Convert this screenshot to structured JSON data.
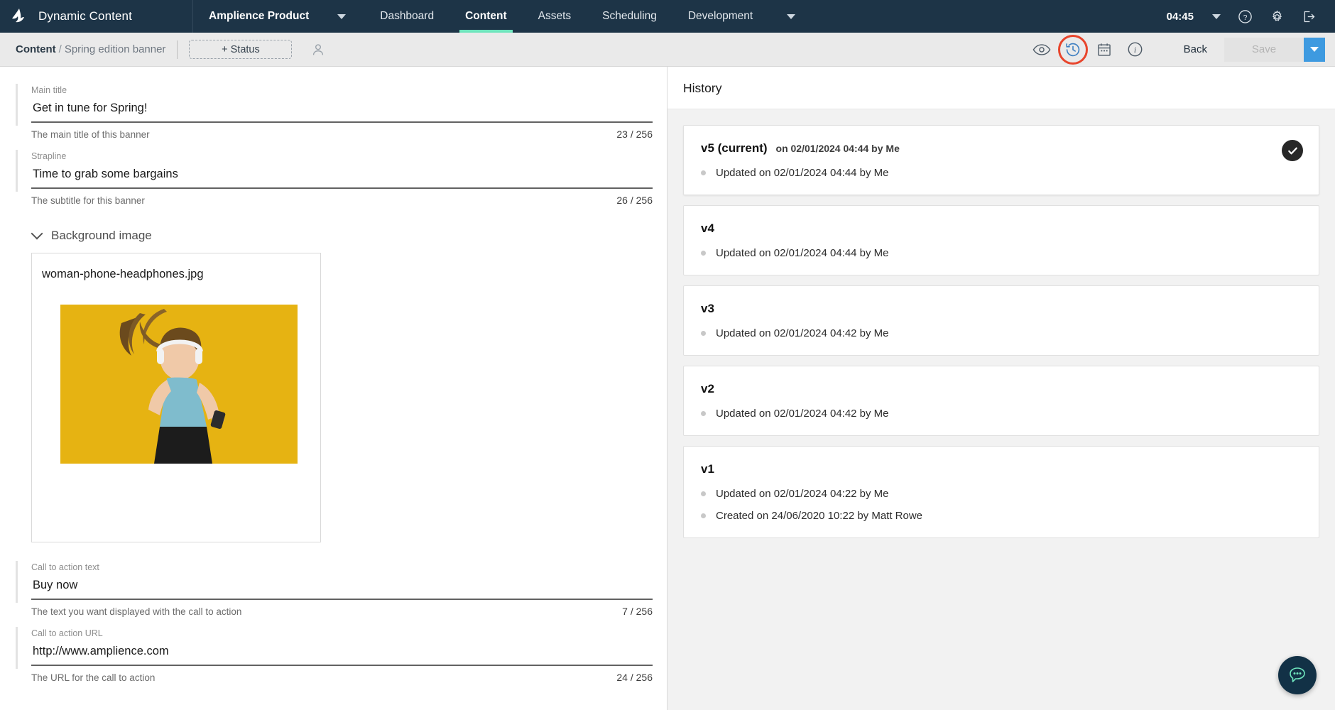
{
  "topnav": {
    "brand": "Dynamic Content",
    "product": "Amplience Product",
    "items": [
      {
        "label": "Dashboard",
        "active": false
      },
      {
        "label": "Content",
        "active": true
      },
      {
        "label": "Assets",
        "active": false
      },
      {
        "label": "Scheduling",
        "active": false
      },
      {
        "label": "Development",
        "active": false
      }
    ],
    "clock": "04:45",
    "icons": [
      "help-icon",
      "gear-icon",
      "logout-icon"
    ],
    "accent": "#6fe5bd",
    "background": "#1d3447"
  },
  "subheader": {
    "breadcrumb_root": "Content",
    "breadcrumb_sep": "/",
    "breadcrumb_leaf": "Spring edition banner",
    "status_label": "+ Status",
    "icons": [
      "preview-eye-icon",
      "history-icon",
      "calendar-icon",
      "info-icon"
    ],
    "highlight_color": "#e8452c",
    "back_label": "Back",
    "save_label": "Save",
    "save_dropdown_color": "#3e9ae0"
  },
  "form": {
    "fields": [
      {
        "label": "Main title",
        "value": "Get in tune for Spring!",
        "help": "The main title of this banner",
        "count": "23 / 256"
      },
      {
        "label": "Strapline",
        "value": "Time to grab some bargains",
        "help": "The subtitle for this banner",
        "count": "26 / 256"
      }
    ],
    "section": {
      "title": "Background image",
      "filename": "woman-phone-headphones.jpg"
    },
    "cta_fields": [
      {
        "label": "Call to action text",
        "value": "Buy now",
        "help": "The text you want displayed with the call to action",
        "count": "7 / 256"
      },
      {
        "label": "Call to action URL",
        "value": "http://www.amplience.com",
        "help": "The URL for the call to action",
        "count": "24 / 256"
      }
    ]
  },
  "history": {
    "title": "History",
    "versions": [
      {
        "version": "v5 (current)",
        "meta": "on 02/01/2024 04:44 by Me",
        "current": true,
        "events": [
          "Updated on 02/01/2024 04:44 by Me"
        ]
      },
      {
        "version": "v4",
        "meta": "",
        "current": false,
        "events": [
          "Updated on 02/01/2024 04:44 by Me"
        ]
      },
      {
        "version": "v3",
        "meta": "",
        "current": false,
        "events": [
          "Updated on 02/01/2024 04:42 by Me"
        ]
      },
      {
        "version": "v2",
        "meta": "",
        "current": false,
        "events": [
          "Updated on 02/01/2024 04:42 by Me"
        ]
      },
      {
        "version": "v1",
        "meta": "",
        "current": false,
        "events": [
          "Updated on 02/01/2024 04:22 by Me",
          "Created on 24/06/2020 10:22 by Matt Rowe"
        ]
      }
    ]
  },
  "chat": {
    "icon": "chat-bubble-icon"
  }
}
